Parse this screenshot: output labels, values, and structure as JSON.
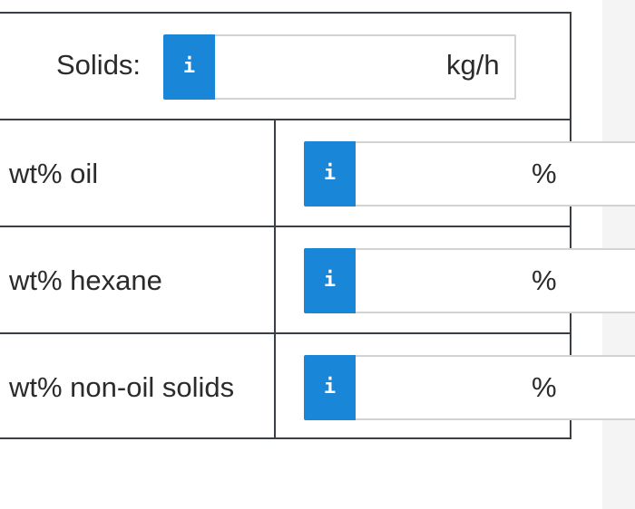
{
  "header_row": {
    "label": "Solids:",
    "info_glyph": "i",
    "value": "",
    "unit": "kg/h"
  },
  "rows": [
    {
      "label": "wt% oil",
      "info_glyph": "i",
      "value": "",
      "unit": "%"
    },
    {
      "label": "wt% hexane",
      "info_glyph": "i",
      "value": "",
      "unit": "%"
    },
    {
      "label": "wt% non-oil solids",
      "info_glyph": "i",
      "value": "",
      "unit": "%"
    }
  ],
  "colors": {
    "info_button": "#1a86d8",
    "border": "#3a3f45",
    "field_border": "#d3d3d3",
    "side_panel": "#f4f4f4"
  },
  "icons": {
    "info": "info-icon"
  }
}
